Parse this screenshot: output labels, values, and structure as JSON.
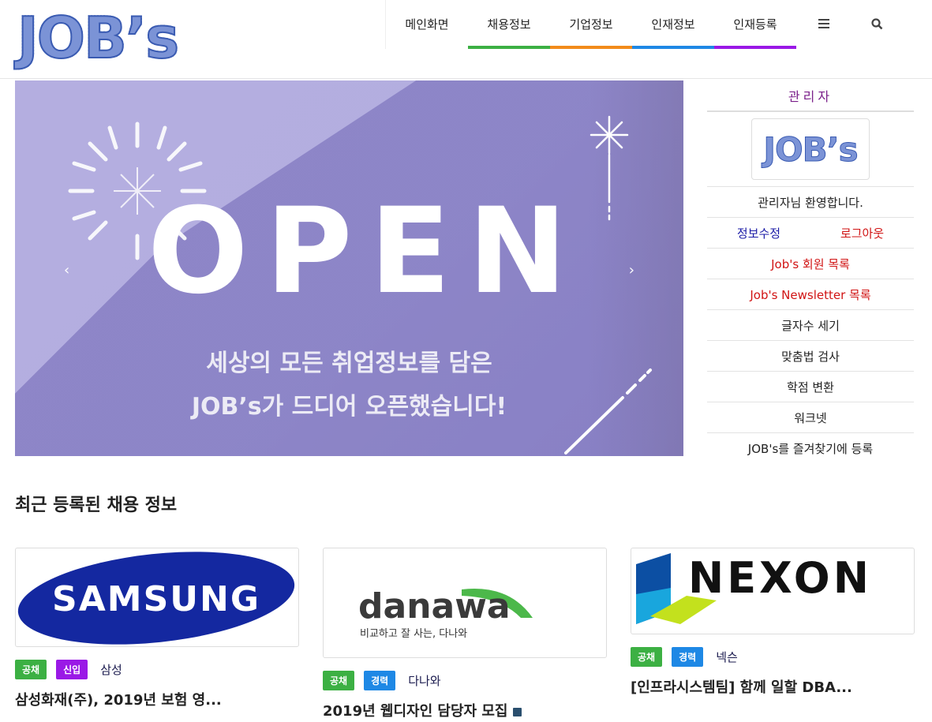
{
  "brand": {
    "logo_text": "JOB’s"
  },
  "nav": {
    "items": [
      {
        "label": "메인화면"
      },
      {
        "label": "채용정보"
      },
      {
        "label": "기업정보"
      },
      {
        "label": "인재정보"
      },
      {
        "label": "인재등록"
      }
    ],
    "menu_icon": "≡",
    "search_icon": "⌕"
  },
  "slider": {
    "headline": "OPEN",
    "line1": "세상의 모든 취업정보를 담은",
    "line2": "JOB’s가 드디어 오픈했습니다!",
    "prev": "‹",
    "next": "›"
  },
  "sidebar": {
    "title": "관리자",
    "logo_text": "JOB’s",
    "welcome": "관리자님 환영합니다.",
    "edit_info": "정보수정",
    "logout": "로그아웃",
    "member_list": "Job's 회원 목록",
    "newsletter_list": "Job's Newsletter 목록",
    "links": [
      "글자수 세기",
      "맞춤법 검사",
      "학점 변환",
      "워크넷",
      "JOB's를 즐겨찾기에 등록"
    ]
  },
  "recent": {
    "title": "최근 등록된 채용 정보",
    "cards": [
      {
        "logo": "SAMSUNG",
        "tags": [
          "공채",
          "신입"
        ],
        "company": "삼성",
        "title": "삼성화재(주), 2019년 보험 영..."
      },
      {
        "logo": "danawa",
        "logo_sub": "비교하고 잘 사는, 다나와",
        "tags": [
          "공채",
          "경력"
        ],
        "company": "다나와",
        "title": "2019년 웹디자인 담당자 모집"
      },
      {
        "logo": "NEXON",
        "tags": [
          "공채",
          "경력"
        ],
        "company": "넥슨",
        "title": "[인프라시스템팀] 함께 일할 DBA..."
      }
    ]
  },
  "colors": {
    "green": "#3cb043",
    "orange": "#f28b1b",
    "blue": "#1e88e5",
    "purple": "#9a19e6",
    "samsung": "#1428a0"
  }
}
